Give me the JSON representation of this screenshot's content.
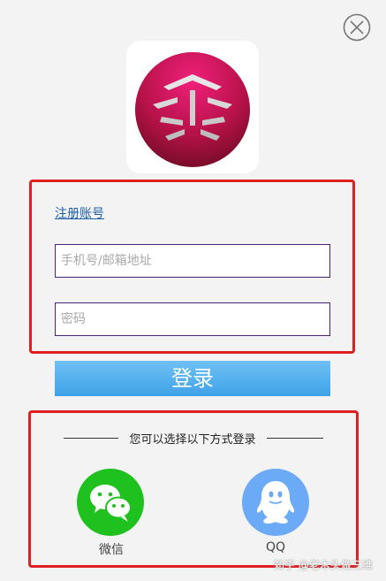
{
  "header": {
    "close_icon": "close-circle-icon"
  },
  "logo": {
    "icon": "app-logo-icon",
    "colors": {
      "sphere_light": "#e0186a",
      "sphere_dark": "#8a0e2e",
      "stripe": "#d0d0d0"
    }
  },
  "login_form": {
    "register_label": "注册账号",
    "phone_email_placeholder": "手机号/邮箱地址",
    "password_placeholder": "密码",
    "login_label": "登录"
  },
  "alt_login": {
    "title": "您可以选择以下方式登录",
    "wechat_label": "微信",
    "wechat_icon": "wechat-icon",
    "qq_label": "QQ",
    "qq_icon": "qq-icon"
  },
  "watermark": {
    "text": "知乎 @老木头做三维"
  },
  "colors": {
    "highlight_border": "#e02020",
    "input_border": "#4b1f7a",
    "link": "#1f5fa8",
    "login_button": "#4aaaee",
    "wechat": "#1ec11e",
    "qq": "#6aaaf6"
  }
}
